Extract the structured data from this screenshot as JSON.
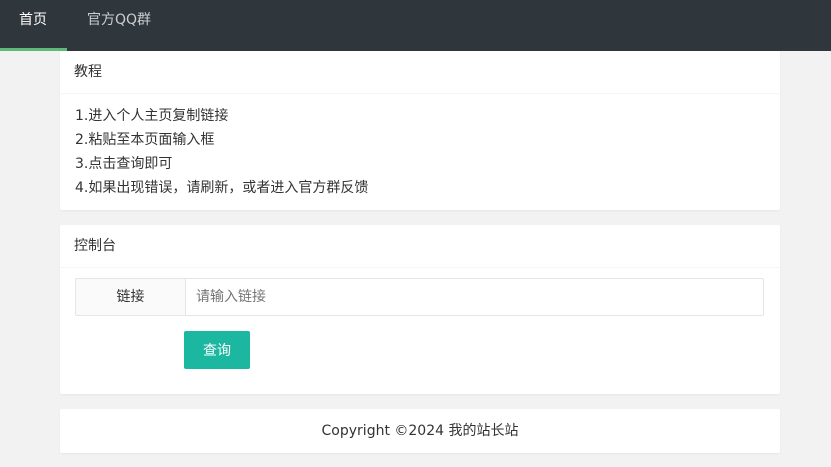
{
  "nav": {
    "items": [
      {
        "label": "首页",
        "active": true
      },
      {
        "label": "官方QQ群",
        "active": false
      }
    ],
    "active_indicator_color": "#5fb878",
    "background_color": "#2f363c"
  },
  "tutorial": {
    "title": "教程",
    "steps": [
      "1.进入个人主页复制链接",
      "2.粘贴至本页面输入框",
      "3.点击查询即可",
      "4.如果出现错误，请刷新，或者进入官方群反馈"
    ]
  },
  "console": {
    "title": "控制台",
    "link_label": "链接",
    "link_placeholder": "请输入链接",
    "link_value": "",
    "query_button": "查询",
    "button_color": "#1cb7a0"
  },
  "footer": {
    "text": "Copyright ©2024 我的站长站"
  }
}
